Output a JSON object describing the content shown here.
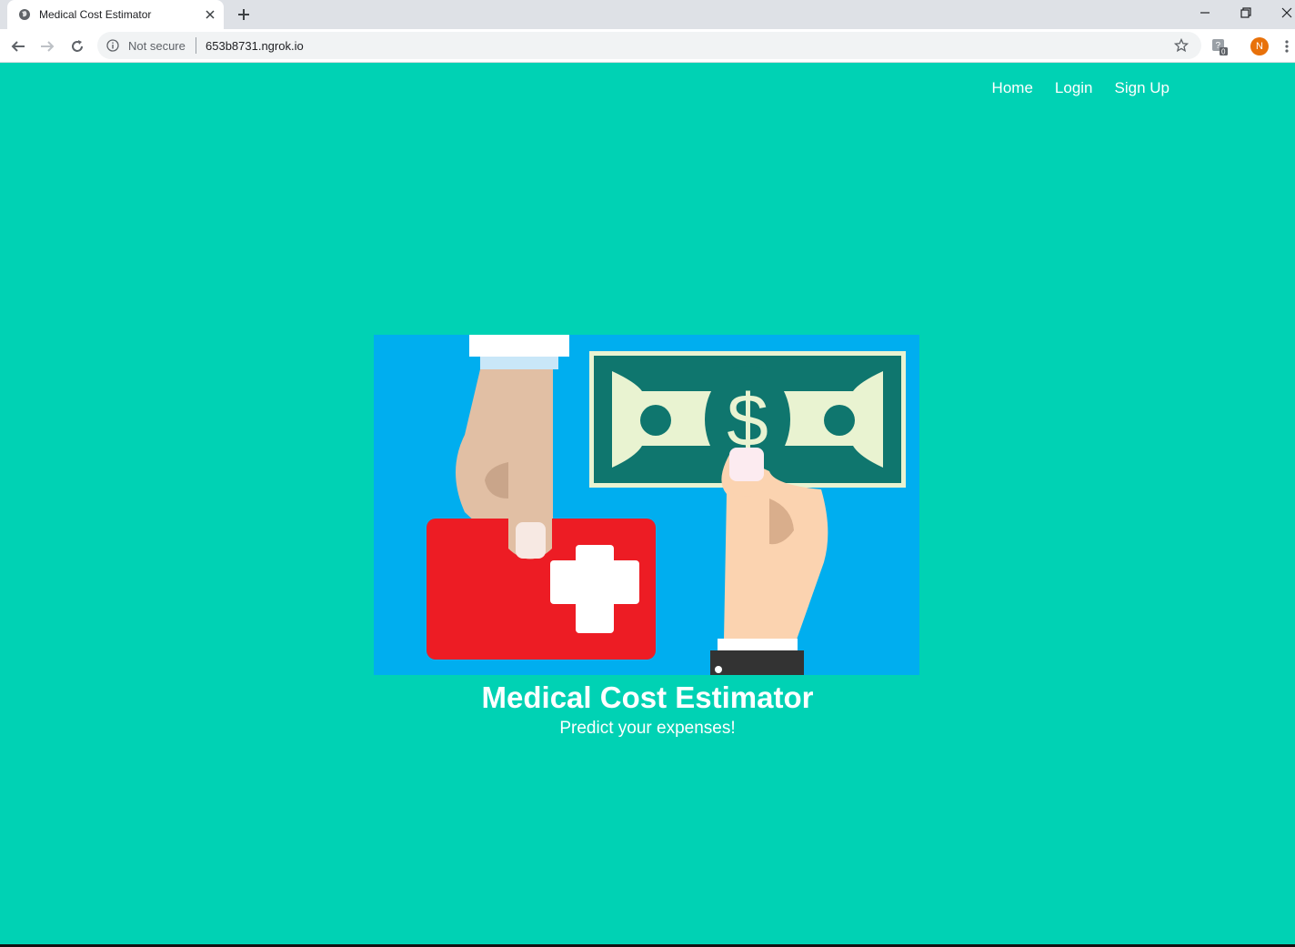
{
  "browser": {
    "tab_title": "Medical Cost Estimator",
    "security_label": "Not secure",
    "url": "653b8731.ngrok.io",
    "profile_initial": "N",
    "extension_badge": "0"
  },
  "nav": {
    "home": "Home",
    "login": "Login",
    "signup": "Sign Up"
  },
  "hero": {
    "title": "Medical Cost Estimator",
    "subtitle": "Predict your expenses!",
    "illustration": "hand-with-first-aid-kit-and-hand-with-dollar-bill"
  },
  "colors": {
    "page_bg": "#00d2b4",
    "illustration_bg": "#00aeef",
    "kit_red": "#ed1c24",
    "bill_green": "#0f766e"
  }
}
